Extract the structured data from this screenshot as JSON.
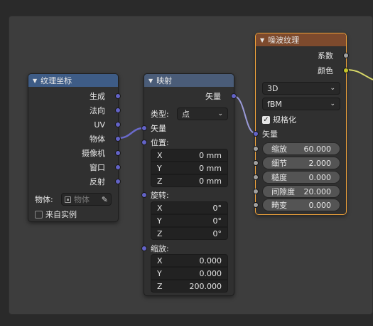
{
  "tex_coord": {
    "title": "纹理坐标",
    "outputs": [
      "生成",
      "法向",
      "UV",
      "物体",
      "摄像机",
      "窗口",
      "反射"
    ],
    "object_label": "物体:",
    "object_placeholder": "物体",
    "from_instancer": "来自实例"
  },
  "mapping": {
    "title": "映射",
    "output": "矢量",
    "type_label": "类型:",
    "type_value": "点",
    "vector_input": "矢量",
    "location_label": "位置:",
    "location": [
      {
        "axis": "X",
        "value": "0 mm"
      },
      {
        "axis": "Y",
        "value": "0 mm"
      },
      {
        "axis": "Z",
        "value": "0 mm"
      }
    ],
    "rotation_label": "旋转:",
    "rotation": [
      {
        "axis": "X",
        "value": "0°"
      },
      {
        "axis": "Y",
        "value": "0°"
      },
      {
        "axis": "Z",
        "value": "0°"
      }
    ],
    "scale_label": "缩放:",
    "scale": [
      {
        "axis": "X",
        "value": "0.000"
      },
      {
        "axis": "Y",
        "value": "0.000"
      },
      {
        "axis": "Z",
        "value": "200.000"
      }
    ]
  },
  "noise": {
    "title": "噪波纹理",
    "outputs": [
      "系数",
      "颜色"
    ],
    "dimensions": "3D",
    "basis": "fBM",
    "normalize_label": "规格化",
    "vector_input": "矢量",
    "sliders": [
      {
        "label": "缩放",
        "value": "60.000"
      },
      {
        "label": "细节",
        "value": "2.000"
      },
      {
        "label": "糙度",
        "value": "0.000"
      },
      {
        "label": "间隙度",
        "value": "20.000"
      },
      {
        "label": "畸变",
        "value": "0.000"
      }
    ]
  },
  "colors": {
    "vector_socket": "#6363c7",
    "float_socket": "#a1a1a1",
    "color_socket": "#c7c729",
    "selected_outline": "#f0a33a"
  }
}
